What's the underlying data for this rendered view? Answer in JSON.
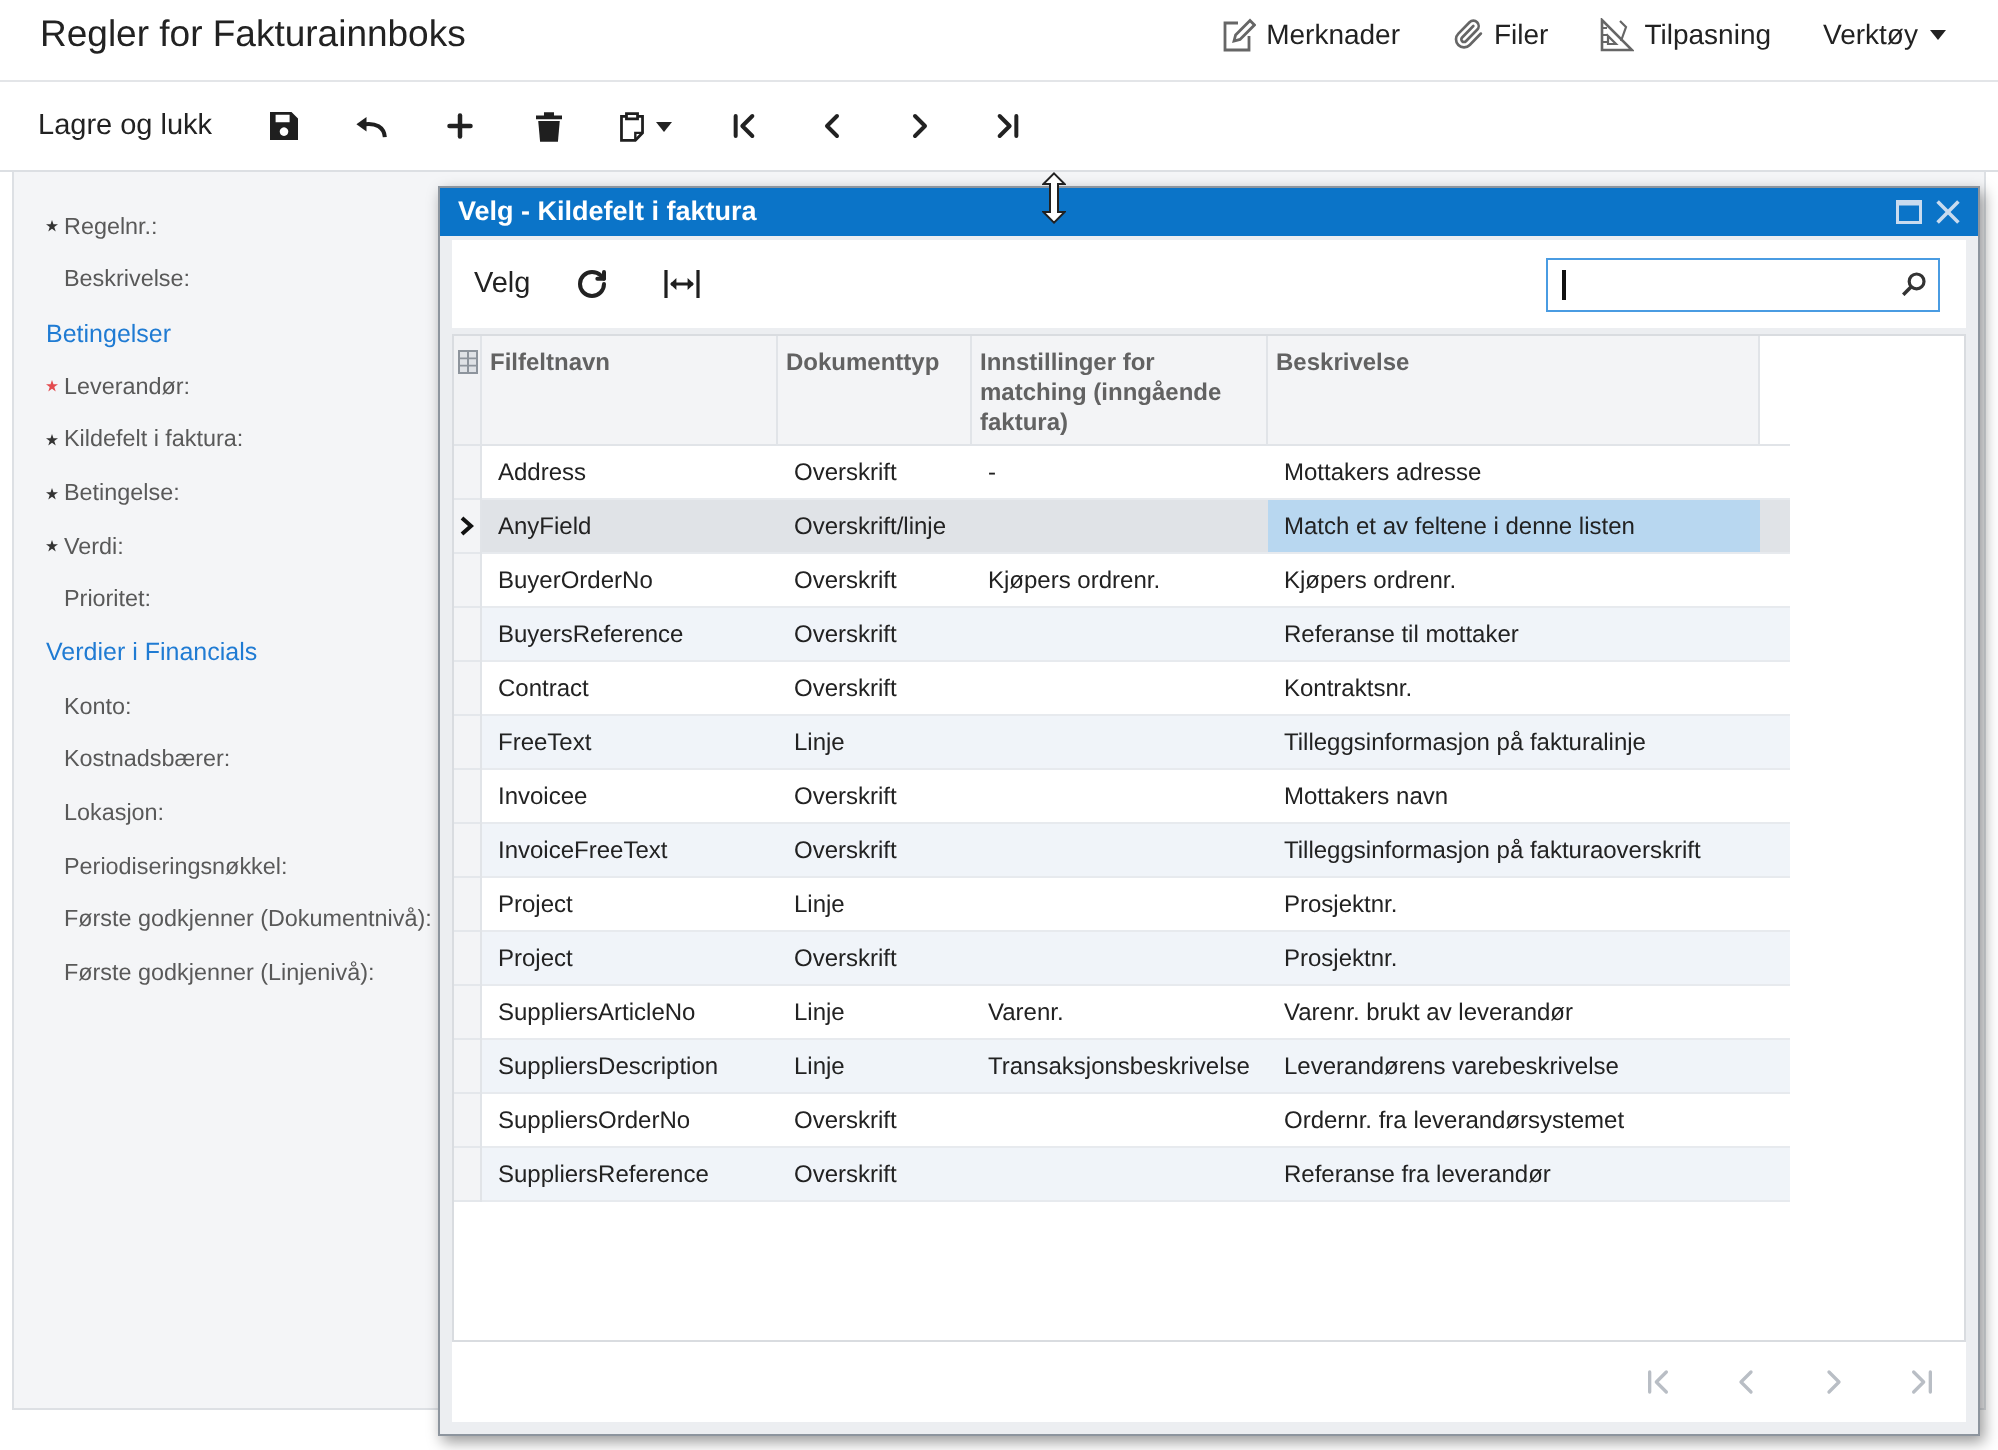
{
  "header": {
    "title": "Regler for Fakturainnboks",
    "actions": [
      {
        "kind": "notes",
        "label": "Merknader"
      },
      {
        "kind": "files",
        "label": "Filer"
      },
      {
        "kind": "customize",
        "label": "Tilpasning"
      },
      {
        "kind": "menu",
        "label": "Verktøy"
      }
    ]
  },
  "toolbar": [
    {
      "kind": "text",
      "label": "Lagre og lukk"
    },
    {
      "kind": "save"
    },
    {
      "kind": "undo"
    },
    {
      "kind": "add"
    },
    {
      "kind": "delete"
    },
    {
      "kind": "paste"
    },
    {
      "kind": "first"
    },
    {
      "kind": "previous"
    },
    {
      "kind": "next"
    },
    {
      "kind": "last"
    }
  ],
  "form": {
    "rows": [
      {
        "kind": "field",
        "label": "Regelnr.:",
        "required": true,
        "error": false
      },
      {
        "kind": "field",
        "label": "Beskrivelse:",
        "required": false,
        "error": false
      },
      {
        "kind": "section",
        "label": "Betingelser"
      },
      {
        "kind": "field",
        "label": "Leverandør:",
        "required": true,
        "error": true
      },
      {
        "kind": "field",
        "label": "Kildefelt i faktura:",
        "required": true,
        "error": false
      },
      {
        "kind": "field",
        "label": "Betingelse:",
        "required": true,
        "error": false
      },
      {
        "kind": "field",
        "label": "Verdi:",
        "required": true,
        "error": false
      },
      {
        "kind": "field",
        "label": "Prioritet:",
        "required": false,
        "error": false
      },
      {
        "kind": "section",
        "label": "Verdier i Financials"
      },
      {
        "kind": "field",
        "label": "Konto:",
        "required": false,
        "error": false
      },
      {
        "kind": "field",
        "label": "Kostnadsbærer:",
        "required": false,
        "error": false
      },
      {
        "kind": "field",
        "label": "Lokasjon:",
        "required": false,
        "error": false
      },
      {
        "kind": "field",
        "label": "Periodiseringsnøkkel:",
        "required": false,
        "error": false
      },
      {
        "kind": "field",
        "label": "Første godkjenner (Dokumentnivå):",
        "required": false,
        "error": false
      },
      {
        "kind": "field",
        "label": "Første godkjenner (Linjenivå):",
        "required": false,
        "error": false
      }
    ]
  },
  "dialog": {
    "title": "Velg - Kildefelt i faktura",
    "toolbar": [
      {
        "kind": "text",
        "label": "Velg"
      },
      {
        "kind": "refresh"
      },
      {
        "kind": "fit-columns"
      }
    ],
    "search": {
      "focused": true
    },
    "table": {
      "columns": [
        {
          "label": "Filfeltnavn",
          "active": false
        },
        {
          "label": "Dokumenttyp",
          "active": false
        },
        {
          "label": "Innstillinger for matching (inngående faktura)",
          "active": false
        },
        {
          "label": "Beskrivelse",
          "active": true
        }
      ],
      "rows": [
        {
          "field_name": "Address",
          "document_type": "Overskrift",
          "matching_setting": "-",
          "description": "Mottakers adresse",
          "selected": false
        },
        {
          "field_name": "AnyField",
          "document_type": "Overskrift/linje",
          "description": "Match et av feltene i denne listen",
          "selected": true
        },
        {
          "field_name": "BuyerOrderNo",
          "document_type": "Overskrift",
          "matching_setting": "Kjøpers ordrenr.",
          "description": "Kjøpers ordrenr.",
          "selected": false
        },
        {
          "field_name": "BuyersReference",
          "document_type": "Overskrift",
          "description": "Referanse til mottaker",
          "selected": false
        },
        {
          "field_name": "Contract",
          "document_type": "Overskrift",
          "description": "Kontraktsnr.",
          "selected": false
        },
        {
          "field_name": "FreeText",
          "document_type": "Linje",
          "description": "Tilleggsinformasjon på fakturalinje",
          "selected": false
        },
        {
          "field_name": "Invoicee",
          "document_type": "Overskrift",
          "description": "Mottakers navn",
          "selected": false
        },
        {
          "field_name": "InvoiceFreeText",
          "document_type": "Overskrift",
          "description": "Tilleggsinformasjon på fakturaoverskrift",
          "selected": false
        },
        {
          "field_name": "Project",
          "document_type": "Linje",
          "description": "Prosjektnr.",
          "selected": false
        },
        {
          "field_name": "Project",
          "document_type": "Overskrift",
          "description": "Prosjektnr.",
          "selected": false
        },
        {
          "field_name": "SuppliersArticleNo",
          "document_type": "Linje",
          "matching_setting": "Varenr.",
          "description": "Varenr. brukt av leverandør",
          "selected": false
        },
        {
          "field_name": "SuppliersDescription",
          "document_type": "Linje",
          "matching_setting": "Transaksjonsbeskrivelse",
          "description": "Leverandørens varebeskrivelse",
          "selected": false
        },
        {
          "field_name": "SuppliersOrderNo",
          "document_type": "Overskrift",
          "description": "Ordernr. fra leverandørsystemet",
          "selected": false
        },
        {
          "field_name": "SuppliersReference",
          "document_type": "Overskrift",
          "description": "Referanse fra leverandør",
          "selected": false
        }
      ]
    },
    "pager": [
      {
        "kind": "first",
        "disabled": true
      },
      {
        "kind": "previous",
        "disabled": true
      },
      {
        "kind": "next",
        "disabled": true
      },
      {
        "kind": "last",
        "disabled": true
      }
    ]
  }
}
